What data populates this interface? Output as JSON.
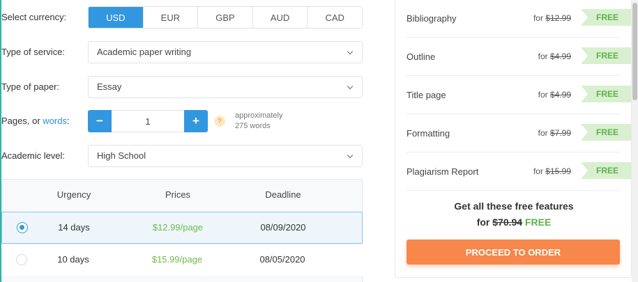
{
  "currency": {
    "label": "Select currency:",
    "options": [
      "USD",
      "EUR",
      "GBP",
      "AUD",
      "CAD"
    ],
    "selected": "USD"
  },
  "service": {
    "label": "Type of service:",
    "value": "Academic paper writing"
  },
  "paper": {
    "label": "Type of paper:",
    "value": "Essay"
  },
  "pages": {
    "label_prefix": "Pages, or ",
    "label_link": "words",
    "label_suffix": ":",
    "minus": "−",
    "plus": "+",
    "value": "1",
    "help": "?",
    "approx_line1": "approximately",
    "approx_line2": "275 words"
  },
  "level": {
    "label": "Academic level:",
    "value": "High School"
  },
  "urgency_table": {
    "headers": [
      "Urgency",
      "Prices",
      "Deadline"
    ],
    "rows": [
      {
        "urgency": "14 days",
        "price": "$12.99/page",
        "deadline": "08/09/2020",
        "selected": true
      },
      {
        "urgency": "10 days",
        "price": "$15.99/page",
        "deadline": "08/05/2020",
        "selected": false
      }
    ]
  },
  "features": [
    {
      "name": "Bibliography",
      "for": "for ",
      "price": "$12.99",
      "badge": "FREE"
    },
    {
      "name": "Outline",
      "for": "for ",
      "price": "$4.99",
      "badge": "FREE"
    },
    {
      "name": "Title page",
      "for": "for ",
      "price": "$4.99",
      "badge": "FREE"
    },
    {
      "name": "Formatting",
      "for": "for ",
      "price": "$7.99",
      "badge": "FREE"
    },
    {
      "name": "Plagiarism Report",
      "for": "for ",
      "price": "$15.99",
      "badge": "FREE"
    }
  ],
  "summary": {
    "line1": "Get all these free features",
    "for": "for ",
    "total": "$70.94",
    "free": "FREE"
  },
  "proceed_label": "PROCEED TO ORDER",
  "colors": {
    "accent": "#3297de",
    "free_green": "#5eb048",
    "cta_orange": "#f7874a"
  }
}
